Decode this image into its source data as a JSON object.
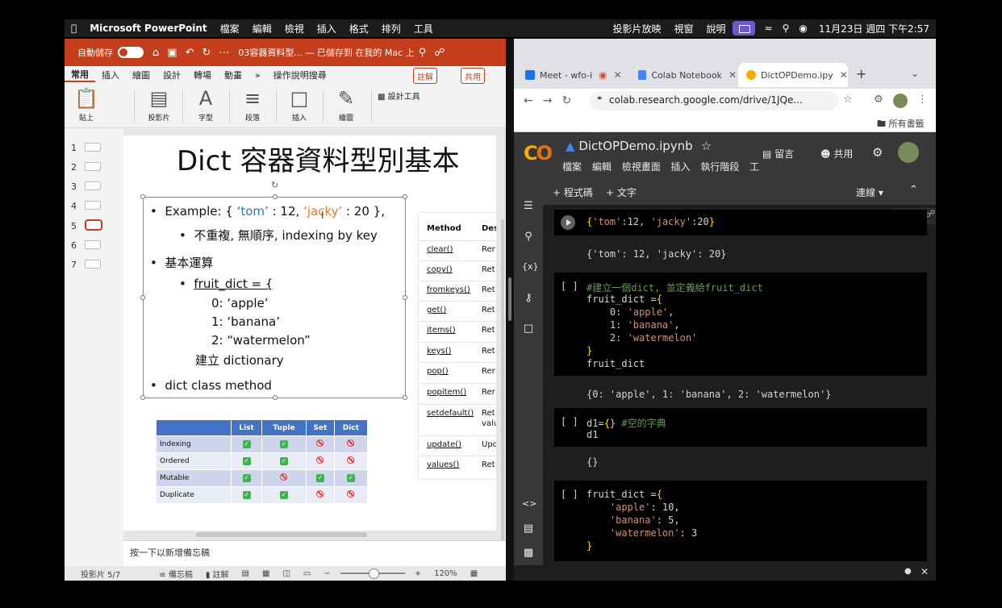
{
  "menubar": {
    "app_name": "Microsoft PowerPoint",
    "items": [
      "檔案",
      "編輯",
      "檢視",
      "插入",
      "格式",
      "排列",
      "工具"
    ],
    "right_items": [
      "投影片放映",
      "視窗",
      "說明"
    ],
    "datetime": "11月23日 週四 下午2:57"
  },
  "ppt": {
    "autosave_label": "自動儲存",
    "toggle_label": "關閉",
    "doc_title": "03容器資料型... — 已儲存到 在我的 Mac 上",
    "tabs": [
      "常用",
      "插入",
      "繪圖",
      "設計",
      "轉場",
      "動畫",
      "»",
      "操作說明搜尋"
    ],
    "comments_label": "註解",
    "share_label": "共用",
    "ribbon": {
      "paste": "貼上",
      "slide": "投影片",
      "font": "字型",
      "paragraph": "段落",
      "insert": "插入",
      "draw": "繪圖",
      "design_tools": "設計工具"
    },
    "thumbs": [
      "1",
      "2",
      "3",
      "4",
      "5",
      "6",
      "7"
    ],
    "slide": {
      "title": "Dict 容器資料型別基本",
      "bullets": {
        "b1_prefix": "Example: { ",
        "b1_tom": "‘tom’",
        "b1_mid": " : 12, ",
        "b1_jacky": "‘jacky’",
        "b1_suffix": " : 20 },",
        "b1_sub": "不重複, 無順序, indexing by key",
        "b2": "基本運算",
        "b2_sub": "fruit_dict = {",
        "l0": "0: ‘apple’",
        "l1": "1: ‘banana’",
        "l2": "2: “watermelon”",
        "l3": "建立 dictionary",
        "b3": "dict class method"
      },
      "methods_header": "Method",
      "desc_header": "Des",
      "methods": [
        {
          "name": "clear()",
          "desc": "Rer"
        },
        {
          "name": "copy()",
          "desc": "Ret"
        },
        {
          "name": "fromkeys()",
          "desc": "Ret"
        },
        {
          "name": "get()",
          "desc": "Ret"
        },
        {
          "name": "items()",
          "desc": "Ret"
        },
        {
          "name": "keys()",
          "desc": "Ret"
        },
        {
          "name": "pop()",
          "desc": "Rer"
        },
        {
          "name": "popitem()",
          "desc": "Rer"
        },
        {
          "name": "setdefault()",
          "desc": "Ret",
          "desc2": "valu"
        },
        {
          "name": "update()",
          "desc": "Upc"
        },
        {
          "name": "values()",
          "desc": "Ret"
        }
      ],
      "compare": {
        "headers": [
          "",
          "List",
          "Tuple",
          "Set",
          "Dict"
        ],
        "rows": [
          {
            "label": "Indexing",
            "vals": [
              "yes",
              "yes",
              "no",
              "no"
            ]
          },
          {
            "label": "Ordered",
            "vals": [
              "yes",
              "yes",
              "no",
              "no"
            ]
          },
          {
            "label": "Mutable",
            "vals": [
              "yes",
              "no",
              "yes",
              "yes"
            ]
          },
          {
            "label": "Duplicate",
            "vals": [
              "yes",
              "yes",
              "no",
              "no"
            ]
          }
        ]
      }
    },
    "notes_placeholder": "按一下以新增備忘稿",
    "status": {
      "slide_count": "投影片 5/7",
      "notes": "備忘稿",
      "comments": "註解",
      "zoom": "120%",
      "zoom_level": 0.5
    }
  },
  "chrome": {
    "tabs": [
      {
        "title": "Meet - wfo-i",
        "color": "#1a73e8"
      },
      {
        "title": "Colab Notebook",
        "color": "#4285f4"
      },
      {
        "title": "DictOPDemo.ipy",
        "color": "#f9ab00"
      }
    ],
    "url": "colab.research.google.com/drive/1JQe...",
    "bookmarks_label": "所有書籤"
  },
  "colab": {
    "notebook_name": "DictOPDemo.ipynb",
    "menu": [
      "檔案",
      "編輯",
      "檢視畫面",
      "插入",
      "執行階段",
      "工"
    ],
    "comment_label": "留言",
    "share_label": "共用",
    "add_code": "+ 程式碼",
    "add_text": "+ 文字",
    "connect": "連線",
    "cells": [
      {
        "bracket": "",
        "lines": [
          "{'tom':12, 'jacky':20}"
        ],
        "output": "{'tom': 12, 'jacky': 20}"
      },
      {
        "bracket": "[ ]",
        "lines": [
          "#建立一個dict, 並定義給fruit_dict",
          "fruit_dict ={",
          "    0: 'apple',",
          "    1: 'banana',",
          "    2: 'watermelon'",
          "}",
          "fruit_dict"
        ],
        "output": "{0: 'apple', 1: 'banana', 2: 'watermelon'}"
      },
      {
        "bracket": "[ ]",
        "lines": [
          "d1={} #空的字典",
          "d1"
        ],
        "output": "{}"
      },
      {
        "bracket": "[ ]",
        "lines": [
          "fruit_dict ={",
          "    'apple': 10,",
          "    'banana': 5,",
          "    'watermelon': 3",
          "}"
        ],
        "output": ""
      }
    ]
  }
}
